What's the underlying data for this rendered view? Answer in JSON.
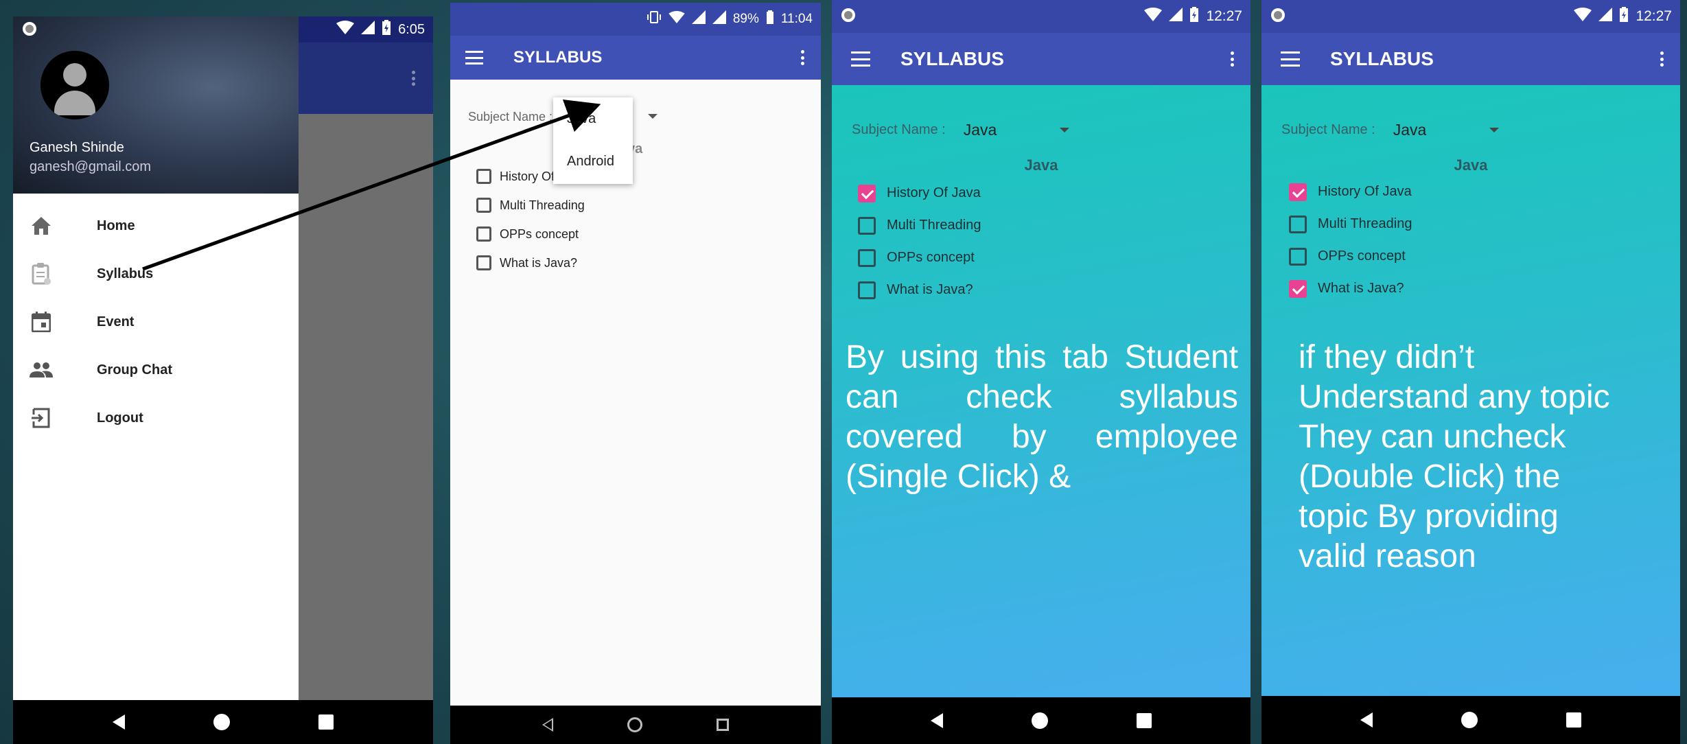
{
  "phone1": {
    "status_time": "6:05",
    "user_name": "Ganesh Shinde",
    "user_email": "ganesh@gmail.com",
    "menu": [
      {
        "label": "Home",
        "icon": "home-icon"
      },
      {
        "label": "Syllabus",
        "icon": "clipboard-icon"
      },
      {
        "label": "Event",
        "icon": "calendar-icon"
      },
      {
        "label": "Group Chat",
        "icon": "group-icon"
      },
      {
        "label": "Logout",
        "icon": "logout-icon"
      }
    ]
  },
  "phone2": {
    "status_battery": "89%",
    "status_time": "11:04",
    "title": "SYLLABUS",
    "subject_label": "Subject Name :",
    "dropdown_options": [
      "Java",
      "Android"
    ],
    "section_heading_partial": "va",
    "topics": [
      {
        "label": "History Of",
        "checked": false
      },
      {
        "label": "Multi Threading",
        "checked": false
      },
      {
        "label": "OPPs concept",
        "checked": false
      },
      {
        "label": "What is Java?",
        "checked": false
      }
    ]
  },
  "phone3": {
    "status_time": "12:27",
    "title": "SYLLABUS",
    "subject_label": "Subject Name :",
    "subject_value": "Java",
    "section_heading": "Java",
    "topics": [
      {
        "label": "History Of Java",
        "checked": true
      },
      {
        "label": "Multi Threading",
        "checked": false
      },
      {
        "label": "OPPs concept",
        "checked": false
      },
      {
        "label": "What is Java?",
        "checked": false
      }
    ],
    "caption": "By using this tab Student can check syllabus covered by employee (Single Click) &"
  },
  "phone4": {
    "status_time": "12:27",
    "title": "SYLLABUS",
    "subject_label": "Subject Name :",
    "subject_value": "Java",
    "section_heading": "Java",
    "topics": [
      {
        "label": "History Of Java",
        "checked": true
      },
      {
        "label": "Multi Threading",
        "checked": false
      },
      {
        "label": "OPPs concept",
        "checked": false
      },
      {
        "label": "What is Java?",
        "checked": true
      }
    ],
    "caption": "if they didn’t Understand any topic They can uncheck (Double Click) the topic By providing valid reason"
  },
  "colors": {
    "primary": "#3f51b5",
    "status_bar": "#3747a8",
    "checkbox_checked": "#e84393",
    "gradient_top": "#16c7b5",
    "gradient_bottom": "#4aaef2"
  }
}
